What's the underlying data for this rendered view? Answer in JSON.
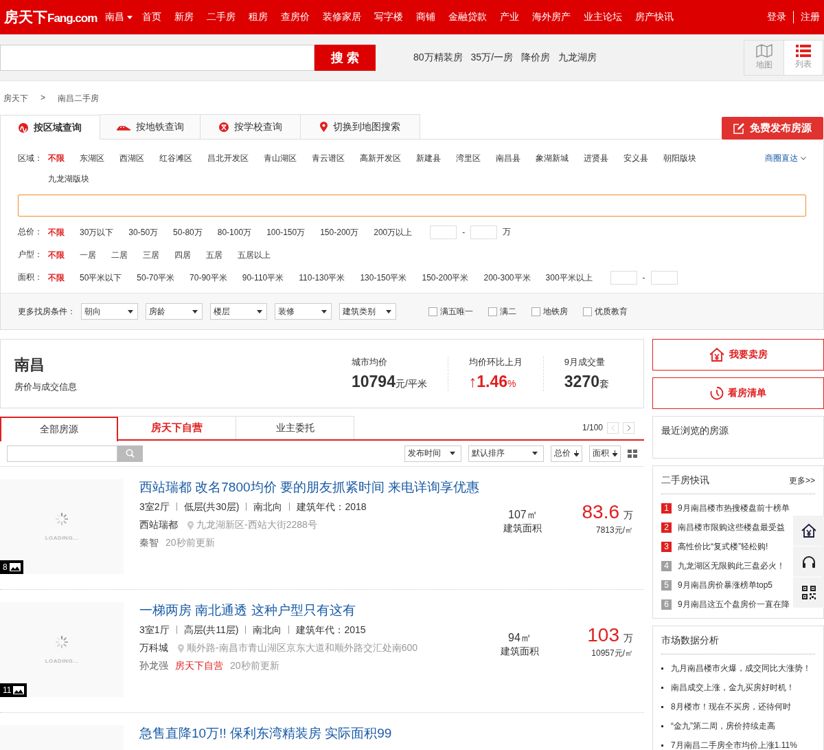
{
  "header": {
    "logo_cn": "房天下",
    "logo_en": "Fang.com",
    "city": "南昌",
    "nav": [
      "首页",
      "新房",
      "二手房",
      "租房",
      "查房价",
      "装修家居",
      "写字楼",
      "商铺",
      "金融贷款",
      "产业",
      "海外房产",
      "业主论坛",
      "房产快讯"
    ],
    "login": "登录",
    "register": "注册"
  },
  "search": {
    "button": "搜 索",
    "hot": [
      "80万精装房",
      "35万/一房",
      "降价房",
      "九龙湖房"
    ],
    "views": [
      {
        "label": "地图",
        "kind": "map",
        "selected": false
      },
      {
        "label": "列表",
        "kind": "list",
        "selected": true
      }
    ]
  },
  "breadcrumb": [
    "房天下",
    ">",
    "南昌二手房"
  ],
  "publish_button": "免费发布房源",
  "filter_tabs": [
    {
      "label": "按区域查询",
      "kind": "area",
      "selected": true
    },
    {
      "label": "按地铁查询",
      "kind": "subway",
      "selected": false
    },
    {
      "label": "按学校查询",
      "kind": "school",
      "selected": false
    },
    {
      "label": "切换到地图搜索",
      "kind": "map",
      "selected": false
    }
  ],
  "region": {
    "label": "区域：",
    "options": [
      {
        "text": "不限",
        "selected": true
      },
      {
        "text": "东湖区",
        "selected": false
      },
      {
        "text": "西湖区",
        "selected": false
      },
      {
        "text": "红谷滩区",
        "selected": false
      },
      {
        "text": "昌北开发区",
        "selected": false
      },
      {
        "text": "青山湖区",
        "selected": false
      },
      {
        "text": "青云谱区",
        "selected": false
      },
      {
        "text": "高新开发区",
        "selected": false
      },
      {
        "text": "新建县",
        "selected": false
      },
      {
        "text": "湾里区",
        "selected": false
      },
      {
        "text": "南昌县",
        "selected": false
      },
      {
        "text": "象湖新城",
        "selected": false
      },
      {
        "text": "进贤县",
        "selected": false
      },
      {
        "text": "安义县",
        "selected": false
      },
      {
        "text": "朝阳版块",
        "selected": false
      },
      {
        "text": "九龙湖版块",
        "selected": false
      }
    ],
    "direct": "商圈直达"
  },
  "filters": [
    {
      "label": "总价：",
      "kind": "range",
      "dash": "-",
      "unit": "万",
      "options": [
        {
          "text": "不限",
          "selected": true
        },
        {
          "text": "30万以下",
          "selected": false
        },
        {
          "text": "30-50万",
          "selected": false
        },
        {
          "text": "50-80万",
          "selected": false
        },
        {
          "text": "80-100万",
          "selected": false
        },
        {
          "text": "100-150万",
          "selected": false
        },
        {
          "text": "150-200万",
          "selected": false
        },
        {
          "text": "200万以上",
          "selected": false
        }
      ]
    },
    {
      "label": "户型：",
      "kind": "plain",
      "options": [
        {
          "text": "不限",
          "selected": true
        },
        {
          "text": "一居",
          "selected": false
        },
        {
          "text": "二居",
          "selected": false
        },
        {
          "text": "三居",
          "selected": false
        },
        {
          "text": "四居",
          "selected": false
        },
        {
          "text": "五居",
          "selected": false
        },
        {
          "text": "五居以上",
          "selected": false
        }
      ]
    },
    {
      "label": "面积：",
      "kind": "range",
      "dash": "-",
      "options": [
        {
          "text": "不限",
          "selected": true
        },
        {
          "text": "50平米以下",
          "selected": false
        },
        {
          "text": "50-70平米",
          "selected": false
        },
        {
          "text": "70-90平米",
          "selected": false
        },
        {
          "text": "90-110平米",
          "selected": false
        },
        {
          "text": "110-130平米",
          "selected": false
        },
        {
          "text": "130-150平米",
          "selected": false
        },
        {
          "text": "150-200平米",
          "selected": false
        },
        {
          "text": "200-300平米",
          "selected": false
        },
        {
          "text": "300平米以上",
          "selected": false
        }
      ]
    }
  ],
  "more": {
    "label": "更多找房条件：",
    "dropdowns": [
      "朝向",
      "房龄",
      "楼层",
      "装修",
      "建筑类别"
    ],
    "checks": [
      {
        "label": "满五唯一",
        "checked": false
      },
      {
        "label": "满二",
        "checked": false
      },
      {
        "label": "地铁房",
        "checked": false
      },
      {
        "label": "优质教育",
        "checked": false
      }
    ]
  },
  "stats": {
    "city": "南昌",
    "subtitle": "房价与成交信息",
    "items": [
      {
        "label": "城市均价",
        "value": "10794",
        "unit": "元/平米",
        "kind": "plain"
      },
      {
        "label": "均价环比上月",
        "arrow": "↑",
        "value": "1.46",
        "unit": "%",
        "kind": "up"
      },
      {
        "label": "9月成交量",
        "value": "3270",
        "unit": "套",
        "kind": "plain"
      }
    ]
  },
  "list_tabs": [
    {
      "label": "全部房源",
      "kind": "plain",
      "selected": true
    },
    {
      "label": "房天下自营",
      "kind": "brand",
      "selected": false
    },
    {
      "label": "业主委托",
      "kind": "plain",
      "selected": false
    }
  ],
  "pager": "1/100",
  "sort": {
    "dropdowns": [
      "发布时间",
      "默认排序"
    ],
    "sorts": [
      "总价",
      "面积"
    ]
  },
  "listings": [
    {
      "title": "西站瑞都 改名7800均价 要的朋友抓紧时间 来电详询享优惠",
      "meta": [
        "3室2厅",
        "低层(共30层)",
        "南北向",
        "建筑年代：2018"
      ],
      "community": "西站瑞都",
      "address": "九龙湖新区-西站大街2288号",
      "agent": "秦智",
      "update": "20秒前更新",
      "photos": "8",
      "loading": "LOADING...",
      "area": "107㎡",
      "area_label": "建筑面积",
      "price": "83.6",
      "price_unit": "万",
      "unit_price": "7813元/㎡"
    },
    {
      "title": "一梯两房 南北通透 这种户型只有这有",
      "meta": [
        "3室1厅",
        "高层(共11层)",
        "南北向",
        "建筑年代：2015"
      ],
      "community": "万科城",
      "address": "顺外路-南昌市青山湖区京东大道和顺外路交汇处南600",
      "agent": "孙龙强",
      "tag": "房天下自营",
      "update": "20秒前更新",
      "photos": "11",
      "loading": "LOADING...",
      "area": "94㎡",
      "area_label": "建筑面积",
      "price": "103",
      "price_unit": "万",
      "unit_price": "10957元/㎡"
    },
    {
      "title": "急售直降10万!! 保利东湾精装房 实际面积99"
    }
  ],
  "sidebar": {
    "sell": "我要卖房",
    "visit": "看房清单",
    "recent": "最近浏览的房源",
    "news": {
      "title": "二手房快讯",
      "more": "更多>>",
      "items": [
        {
          "num": "1",
          "text": "9月南昌楼市热搜楼盘前十榜单",
          "color": "#e02020"
        },
        {
          "num": "2",
          "text": "南昌楼市限购这些楼盘最受益",
          "color": "#e02020"
        },
        {
          "num": "3",
          "text": "高性价比“复式楼”轻松购!",
          "color": "#e02020"
        },
        {
          "num": "4",
          "text": "九龙湖区无限购此三盘必火！",
          "color": "#a0a0a0"
        },
        {
          "num": "5",
          "text": "9月南昌房价暴涨榜单top5",
          "color": "#a0a0a0"
        },
        {
          "num": "6",
          "text": "9月南昌这五个盘房价一直在降",
          "color": "#a0a0a0"
        }
      ]
    },
    "market": {
      "title": "市场数据分析",
      "items": [
        "九月南昌楼市火爆，成交同比大涨势！",
        "南昌成交上涨，金九买房好时机！",
        "8月楼市！现在不买房，还待何时",
        "“金九”第二周，房价持续走高",
        "7月南昌二手房全市均价上涨1.11%"
      ]
    }
  }
}
